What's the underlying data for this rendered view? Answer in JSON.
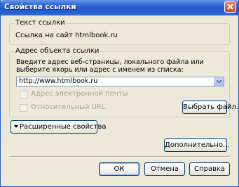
{
  "window": {
    "title": "Свойства ссылки"
  },
  "link_text": {
    "legend": "Текст ссылки",
    "value": "Ссылка на сайт htmlbook.ru"
  },
  "link_target": {
    "legend": "Адрес объекта ссылки",
    "instructions": "Введите адрес веб-страницы, локального файла или выберите якорь или адрес с именем из списка:",
    "url_value": "http://www.htmlbook.ru",
    "email_checkbox_label": "Адрес электронной почты",
    "relative_checkbox_label": "Относительный URL",
    "choose_file_label": "Выбрать файл..."
  },
  "advanced_toggle_label": "Расширенные свойства",
  "more_button_label": "Дополнительно...",
  "buttons": {
    "ok": "ОК",
    "cancel": "Отмена",
    "help": "Справка"
  }
}
